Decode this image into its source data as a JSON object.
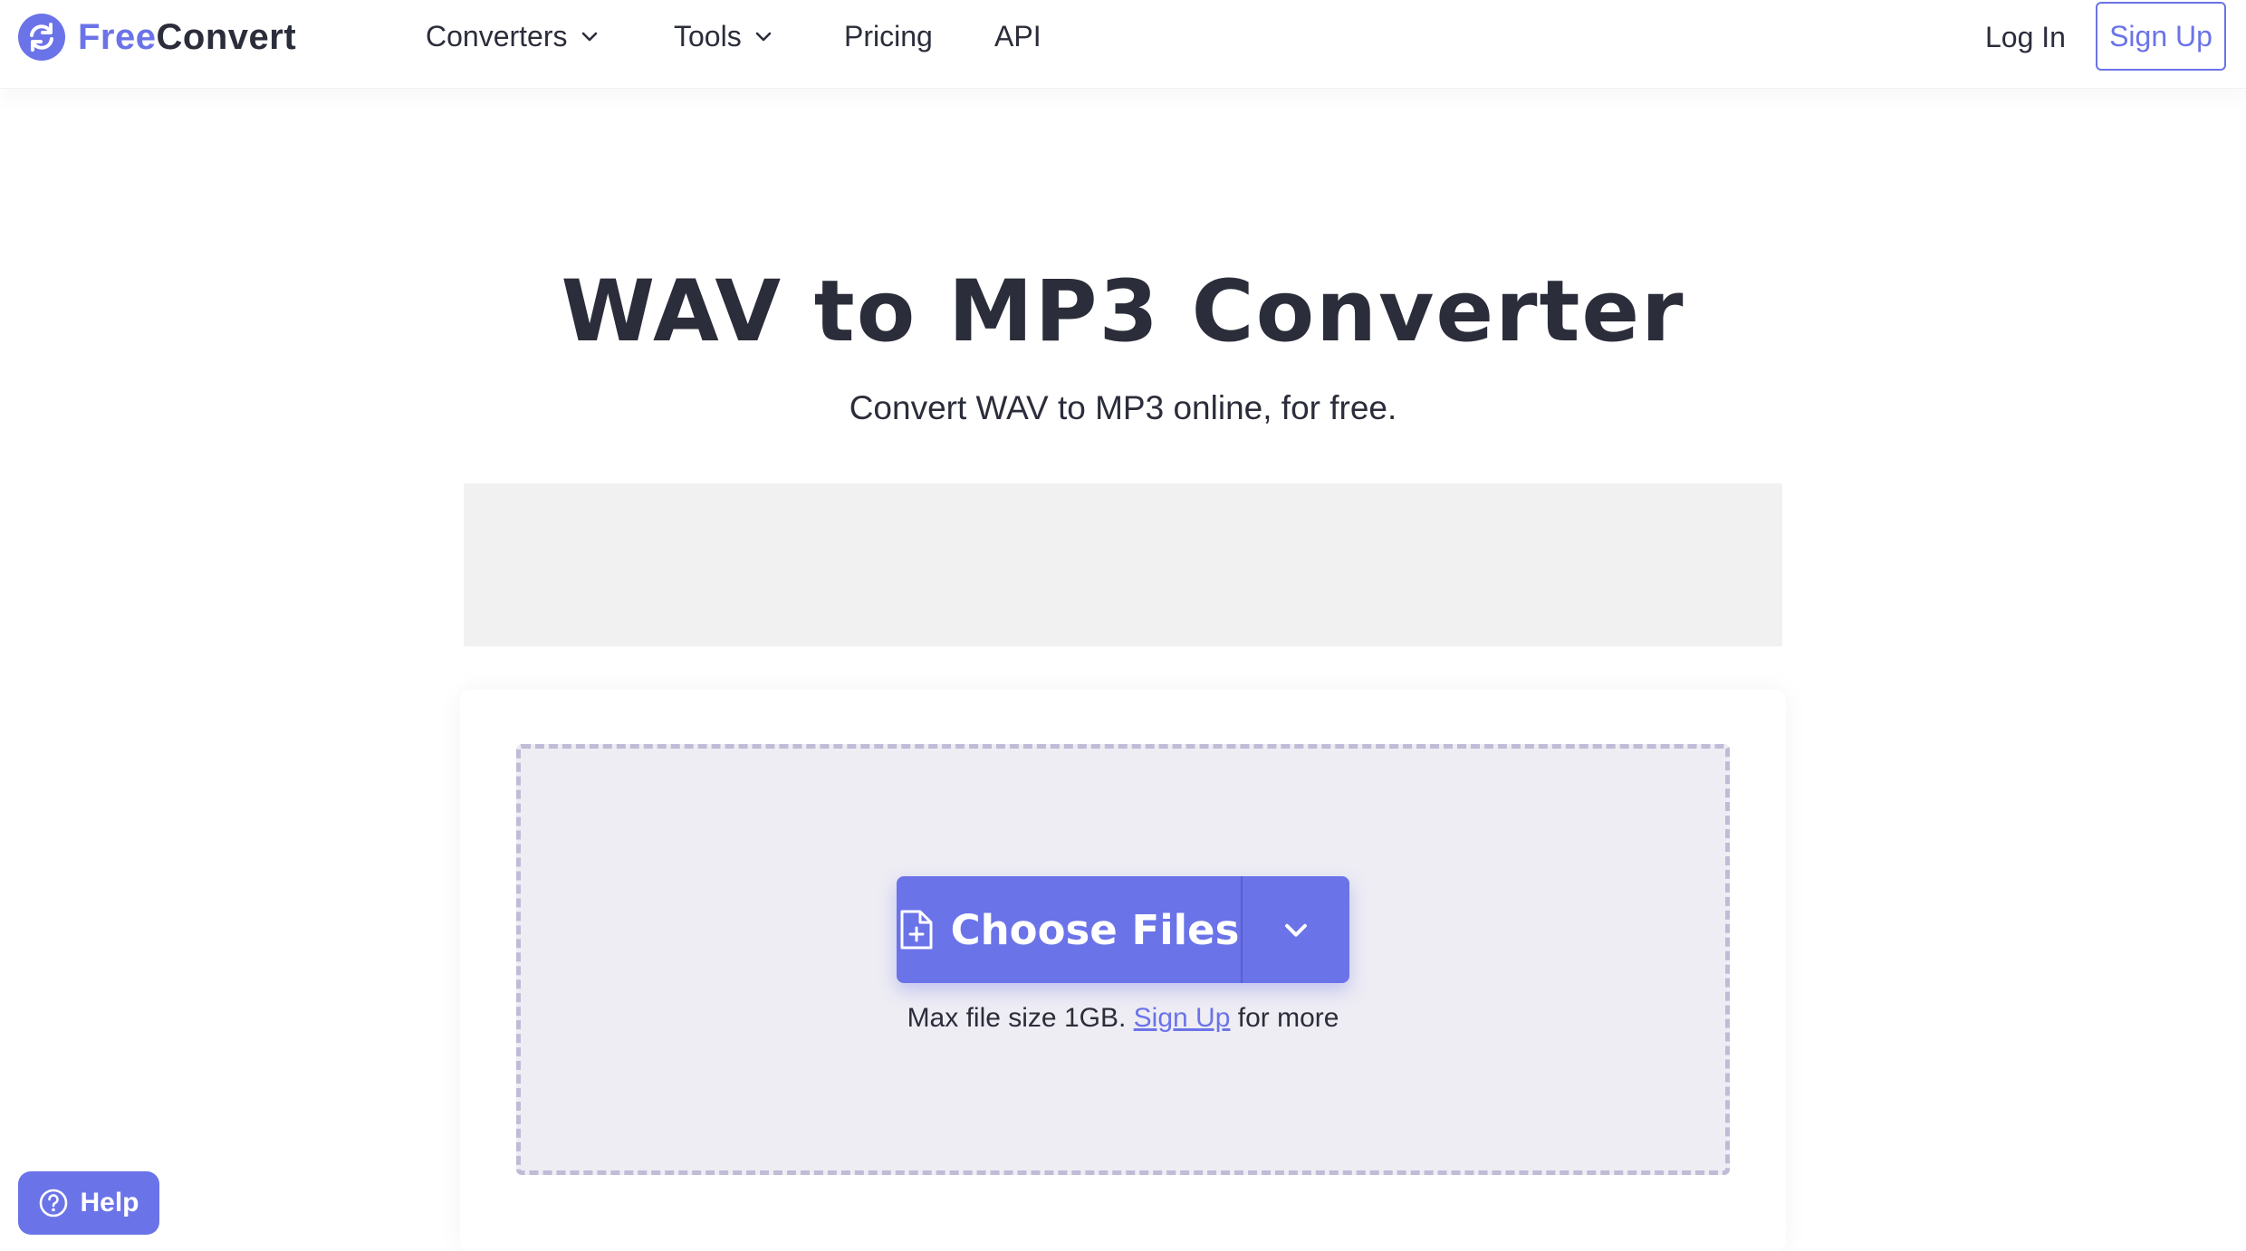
{
  "brand": {
    "name_part1": "Free",
    "name_part2": "Convert",
    "accent_color": "#6b73e8"
  },
  "nav": {
    "converters": "Converters",
    "tools": "Tools",
    "pricing": "Pricing",
    "api": "API",
    "login": "Log In",
    "signup": "Sign Up"
  },
  "hero": {
    "title": "WAV to MP3 Converter",
    "subtitle": "Convert WAV to MP3 online, for free."
  },
  "upload": {
    "choose_label": "Choose Files",
    "choose_icon": "file-plus-icon",
    "dropdown_icon": "chevron-down-icon",
    "max_text": "Max file size 1GB.",
    "signup_link": "Sign Up",
    "more_text": "for more"
  },
  "help": {
    "label": "Help",
    "icon": "question-circle-icon"
  }
}
